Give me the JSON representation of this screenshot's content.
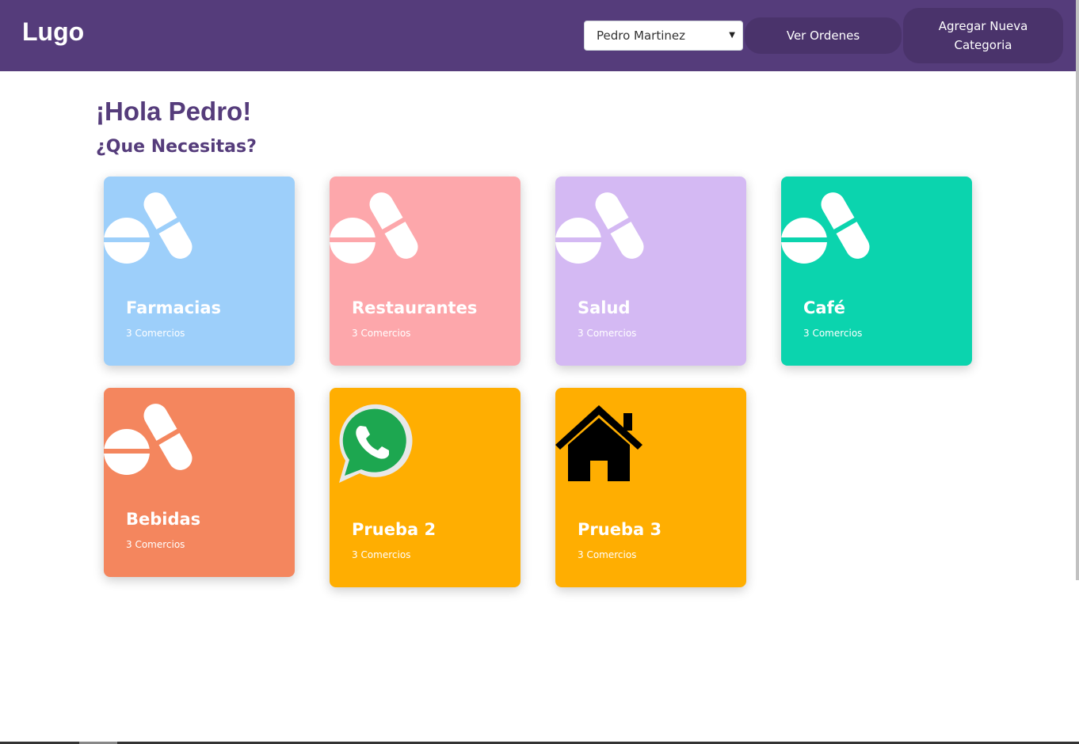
{
  "navbar": {
    "brand": "Lugo",
    "user_select": {
      "selected": "Pedro Martinez"
    },
    "orders_button": "Ver Ordenes",
    "add_category_button": "Agregar Nueva Categoria",
    "color": "#553c7b",
    "button_color": "#4a336b"
  },
  "main": {
    "greeting": "¡Hola Pedro!",
    "subtitle": "¿Que Necesitas?",
    "categories": [
      {
        "name": "Farmacias",
        "count": "3 Comercios",
        "color": "#9dcffa",
        "icon": "pills-icon"
      },
      {
        "name": "Restaurantes",
        "count": "3 Comercios",
        "color": "#fda7ab",
        "icon": "pills-icon"
      },
      {
        "name": "Salud",
        "count": "3 Comercios",
        "color": "#d4b9f3",
        "icon": "pills-icon"
      },
      {
        "name": "Café",
        "count": "3 Comercios",
        "color": "#0bd4ae",
        "icon": "pills-icon"
      },
      {
        "name": "Bebidas",
        "count": "3 Comercios",
        "color": "#f4865e",
        "icon": "pills-icon"
      },
      {
        "name": "Prueba 2",
        "count": "3 Comercios",
        "color": "#ffae01",
        "icon": "whatsapp-icon"
      },
      {
        "name": "Prueba 3",
        "count": "3 Comercios",
        "color": "#ffae01",
        "icon": "house-icon"
      }
    ]
  }
}
